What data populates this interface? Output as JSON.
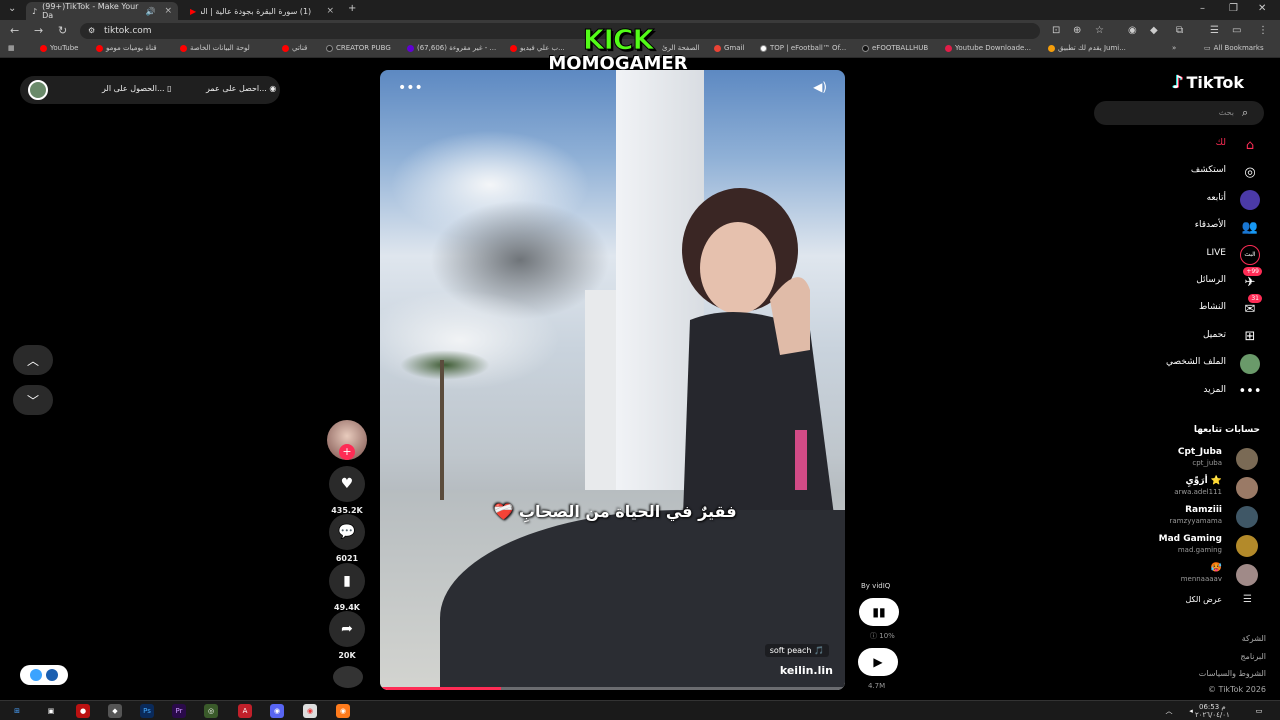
{
  "browser": {
    "tabs": [
      {
        "title": "(99+)TikTok - Make Your Da",
        "active": true
      },
      {
        "title": "(1) سورة البقرة بجودة عالية | الش",
        "active": false
      }
    ],
    "new_tab": "+",
    "url": "tiktok.com",
    "bookmarks": [
      {
        "label": "YouTube",
        "color": "#ff0000"
      },
      {
        "label": "قناة يوميات مومو",
        "color": "#ff0000"
      },
      {
        "label": "لوحة البيانات الخاصة",
        "color": "#ff0000"
      },
      {
        "label": "قناتي",
        "color": "#ff0000"
      },
      {
        "label": "CREATOR PUBG",
        "color": "#222222"
      },
      {
        "label": "(67,606) غير مقروءة - ...",
        "color": "#6001d2"
      },
      {
        "label": "ب علي فيديو...",
        "color": "#ff0000"
      },
      {
        "label": "الصفحة الرئ",
        "color": "#ffffff"
      },
      {
        "label": "Gmail",
        "color": "#ea4335"
      },
      {
        "label": "TOP | eFootball™ Of...",
        "color": "#1e3a8a"
      },
      {
        "label": "eFOOTBALLHUB",
        "color": "#111111"
      },
      {
        "label": "Youtube Downloade...",
        "color": "#e11d48"
      },
      {
        "label": "يقدم لك تطبيق Jumi...",
        "color": "#f59e0b"
      }
    ],
    "all_bookmarks": "All Bookmarks"
  },
  "overlay": {
    "line1": "KICK",
    "line2": "MOMOGAMER"
  },
  "top_pill": {
    "item1": "احصل على عمر...",
    "item2": "الحصول على الر..."
  },
  "video": {
    "caption": "فقيرٌ في الحياة من الصحابِ ❤️‍🩹",
    "music": "soft peach 🎵",
    "author": "keilin.lin",
    "progress": 0.26
  },
  "actions": {
    "likes": "435.2K",
    "comments": "6021",
    "saves": "49.4K",
    "shares": "20K"
  },
  "vidiq": {
    "by": "By vidIQ",
    "percent": "10%",
    "views": "4.7M"
  },
  "sidebar": {
    "logo": "TikTok",
    "search_placeholder": "بحث",
    "nav": [
      {
        "label": "لك",
        "icon": "home-icon",
        "glyph": "⌂",
        "active": true
      },
      {
        "label": "استكشف",
        "icon": "compass-icon",
        "glyph": "◎",
        "active": false
      },
      {
        "label": "أتابعه",
        "icon": "following-avatar-icon",
        "glyph": "●",
        "active": false
      },
      {
        "label": "الأصدقاء",
        "icon": "friends-icon",
        "glyph": "👥",
        "active": false
      },
      {
        "label": "LIVE",
        "icon": "live-icon",
        "glyph": "البث",
        "active": false
      },
      {
        "label": "الرسائل",
        "icon": "messages-icon",
        "glyph": "✈",
        "badge": "+99",
        "active": false
      },
      {
        "label": "النشاط",
        "icon": "activity-icon",
        "glyph": "✉",
        "badge": "31",
        "active": false
      },
      {
        "label": "تحميل",
        "icon": "upload-icon",
        "glyph": "⊞",
        "active": false
      },
      {
        "label": "الملف الشخصي",
        "icon": "profile-avatar-icon",
        "glyph": "●",
        "active": false
      },
      {
        "label": "المزيد",
        "icon": "more-icon",
        "glyph": "•••",
        "active": false
      }
    ],
    "following_title": "حسابات تتابعها",
    "following": [
      {
        "name": "Cpt_Juba",
        "user": "cpt_juba",
        "color": "#7a6a55"
      },
      {
        "name": "أرَوِّيِ ⭐",
        "user": "arwa.adel111",
        "color": "#9a7a66"
      },
      {
        "name": "Ramziii",
        "user": "ramzyyamama",
        "color": "#3f5766"
      },
      {
        "name": "Mad Gaming",
        "user": "mad.gaming",
        "color": "#b38a2a"
      },
      {
        "name": "🥵",
        "user": "mennaaaav",
        "color": "#a08a88"
      }
    ],
    "show_all": "عرض الكل",
    "footer": [
      "الشركة",
      "البرنامج",
      "الشروط والسياسات",
      "TikTok 2026 ©"
    ]
  },
  "taskbar": {
    "time": "06:53 م",
    "date": "٢٠٢٦/٠٤/٠١"
  }
}
